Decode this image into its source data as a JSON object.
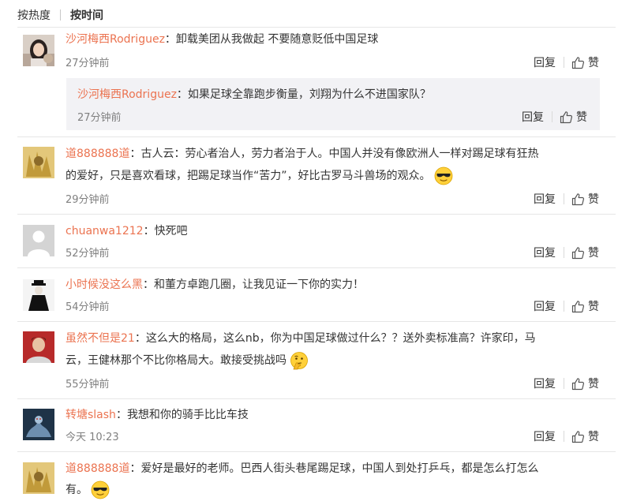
{
  "sort": {
    "hot": "按热度",
    "time": "按时间"
  },
  "actions": {
    "reply": "回复",
    "like": "赞"
  },
  "comments": [
    {
      "user": "沙河梅西Rodriguez",
      "text": "卸载美团从我做起  不要随意贬低中国足球",
      "time": "27分钟前",
      "reply": {
        "user": "沙河梅西Rodriguez",
        "text": "如果足球全靠跑步衡量，刘翔为什么不进国家队？",
        "time": "27分钟前"
      }
    },
    {
      "user": "道888888道",
      "text1": "古人云：劳心者治人，劳力者治于人。中国人并没有像欧洲人一样对踢足球有狂热",
      "text2": "的爱好，只是喜欢看球，把踢足球当作“苦力”，好比古罗马斗兽场的观众。",
      "emoji": "cool-emoji",
      "time": "29分钟前"
    },
    {
      "user": "chuanwa1212",
      "text": "快死吧",
      "time": "52分钟前"
    },
    {
      "user": "小时候没这么黑",
      "text": "和董方卓跑几圈，让我见证一下你的实力！",
      "time": "54分钟前"
    },
    {
      "user": "虽然不但是21",
      "text1": "这么大的格局，这么nb，你为中国足球做过什么？？送外卖标准高？许家印，马",
      "text2": "云，王健林那个不比你格局大。敢接受挑战吗",
      "emoji": "thinking-emoji",
      "time": "55分钟前"
    },
    {
      "user": "转塘slash",
      "text": "我想和你的骑手比比车技",
      "time": "今天 10:23"
    },
    {
      "user": "道888888道",
      "text1": "爱好是最好的老师。巴西人街头巷尾踢足球，中国人到处打乒乓，都是怎么打怎么",
      "text2": "有。",
      "emoji": "cool-emoji"
    }
  ]
}
